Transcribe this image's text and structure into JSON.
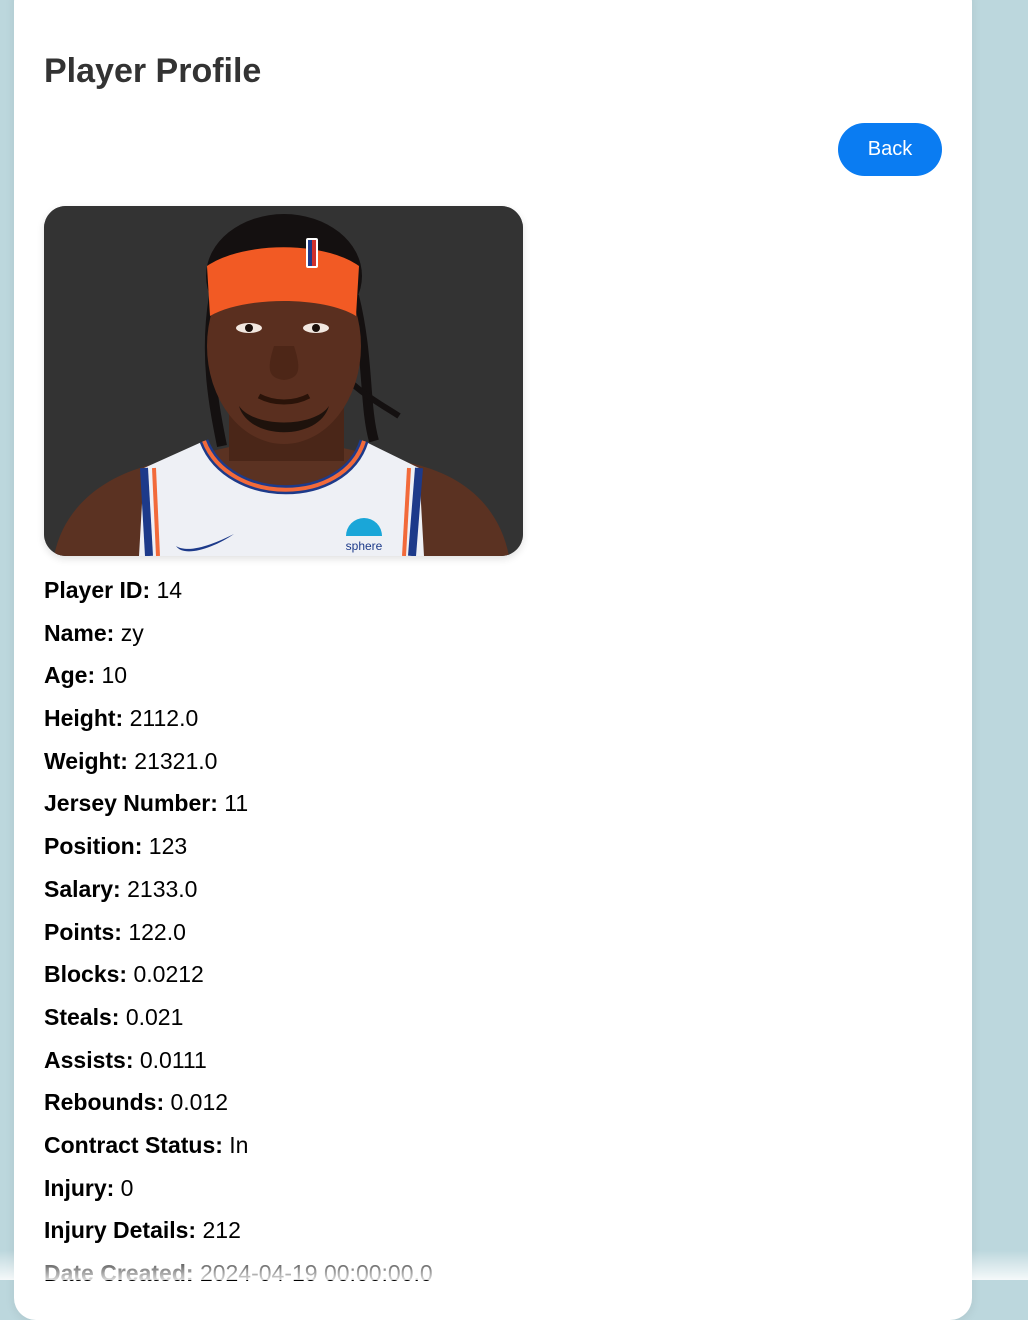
{
  "page": {
    "title": "Player Profile",
    "back_label": "Back"
  },
  "colors": {
    "background": "#bcd7dd",
    "card": "#ffffff",
    "accent": "#0a7cf2",
    "photo_background": "#333333"
  },
  "photo": {
    "jersey_sponsor": "sphere"
  },
  "fields": [
    {
      "label": "Player ID:",
      "value": "14"
    },
    {
      "label": "Name:",
      "value": "zy"
    },
    {
      "label": "Age:",
      "value": "10"
    },
    {
      "label": "Height:",
      "value": "2112.0"
    },
    {
      "label": "Weight:",
      "value": "21321.0"
    },
    {
      "label": "Jersey Number:",
      "value": "11"
    },
    {
      "label": "Position:",
      "value": "123"
    },
    {
      "label": "Salary:",
      "value": "2133.0"
    },
    {
      "label": "Points:",
      "value": "122.0"
    },
    {
      "label": "Blocks:",
      "value": "0.0212"
    },
    {
      "label": "Steals:",
      "value": "0.021"
    },
    {
      "label": "Assists:",
      "value": "0.0111"
    },
    {
      "label": "Rebounds:",
      "value": "0.012"
    },
    {
      "label": "Contract Status:",
      "value": "In"
    },
    {
      "label": "Injury:",
      "value": "0"
    },
    {
      "label": "Injury Details:",
      "value": "212"
    },
    {
      "label": "Date Created:",
      "value": "2024-04-19 00:00:00.0"
    }
  ]
}
